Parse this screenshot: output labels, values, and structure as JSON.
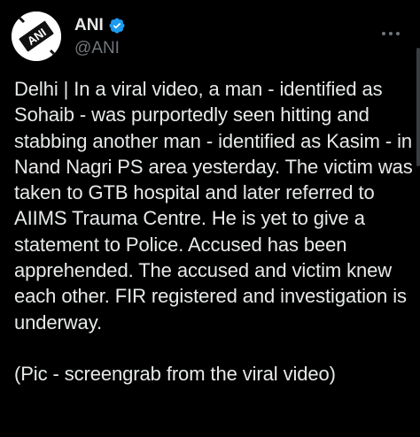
{
  "tweet": {
    "author": {
      "display_name": "ANI",
      "handle": "@ANI",
      "avatar_logo_text": "ANI",
      "verified": true
    },
    "icons": {
      "verified": "verified-badge-icon",
      "more": "more-options-icon"
    },
    "body": "Delhi | In a viral video, a man - identified as Sohaib - was purportedly seen hitting and stabbing another man - identified as Kasim - in Nand Nagri PS area yesterday. The victim was taken to GTB hospital and later referred to AIIMS Trauma Centre. He is yet to give a statement to Police. Accused has been apprehended. The accused and victim knew each other. FIR registered and investigation is underway.\n\n(Pic - screengrab from the viral video)"
  },
  "colors": {
    "background": "#000000",
    "text_primary": "#e7e9ea",
    "text_secondary": "#71767b",
    "verified_badge": "#1d9bf0"
  }
}
